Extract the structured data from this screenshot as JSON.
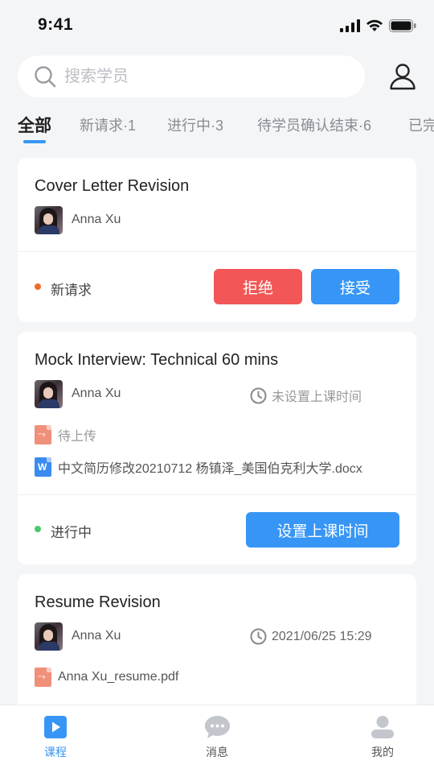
{
  "status_bar": {
    "time": "9:41"
  },
  "search": {
    "placeholder": "搜索学员"
  },
  "tabs": [
    {
      "label": "全部"
    },
    {
      "label": "新请求·1"
    },
    {
      "label": "进行中·3"
    },
    {
      "label": "待学员确认结束·6"
    },
    {
      "label": "已完"
    }
  ],
  "cards": [
    {
      "title": "Cover Letter Revision",
      "student": "Anna Xu",
      "status": "新请求",
      "status_color": "#F26B2B",
      "reject_label": "拒绝",
      "accept_label": "接受"
    },
    {
      "title": "Mock Interview: Technical 60 mins",
      "student": "Anna Xu",
      "time": "未设置上课时间",
      "upload_status": "待上传",
      "file": "中文简历修改20210712 杨镇泽_美国伯克利大学.docx",
      "status": "进行中",
      "status_color": "#4CC76A",
      "action_label": "设置上课时间"
    },
    {
      "title": "Resume Revision",
      "student": "Anna Xu",
      "time": "2021/06/25 15:29",
      "file": "Anna Xu_resume.pdf"
    }
  ],
  "nav": [
    {
      "label": "课程",
      "icon": "course-play-icon",
      "active": true
    },
    {
      "label": "消息",
      "icon": "message-bubble-icon"
    },
    {
      "label": "我的",
      "icon": "profile-icon"
    }
  ],
  "colors": {
    "accent": "#3796F5",
    "reject": "#F25656",
    "background": "#F4F5F7"
  }
}
